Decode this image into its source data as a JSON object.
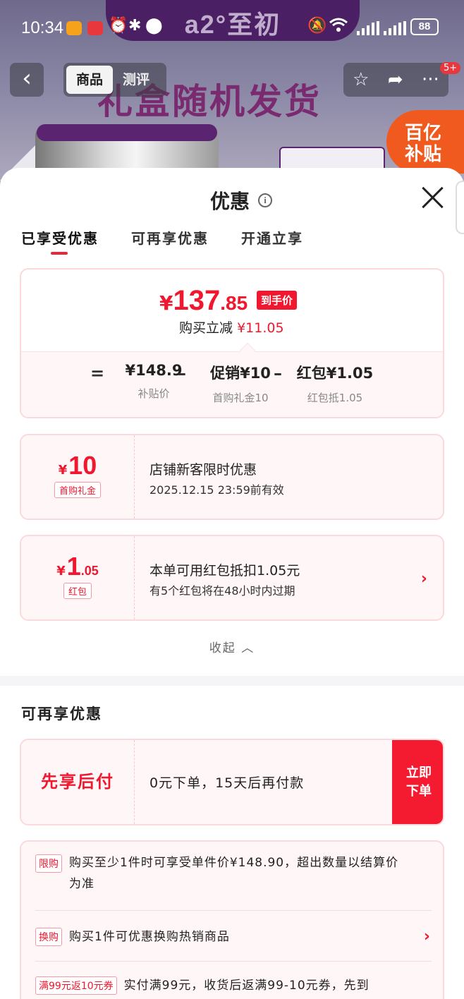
{
  "status_bar": {
    "time": "10:34",
    "battery": "88",
    "network": "6"
  },
  "background": {
    "brand": "a2°至初",
    "banner": "礼盒随机发货",
    "subsidy_badge": "百亿补贴"
  },
  "nav": {
    "tabs": [
      "商品",
      "测评"
    ],
    "active_tab": "商品",
    "badge": "5+"
  },
  "sheet": {
    "title": "优惠",
    "tabs": [
      "已享受优惠",
      "可再享优惠",
      "开通立享"
    ],
    "active_tab_index": 0
  },
  "price_summary": {
    "symbol": "¥",
    "price_int": "137",
    "price_dec": ".85",
    "price_tag": "到手价",
    "reduce_label": "购买立减",
    "reduce_amount": "¥11.05",
    "breakdown": [
      {
        "op": "=",
        "value": "¥148.9",
        "sub": "补贴价"
      },
      {
        "op": "–",
        "value": "促销¥10",
        "sub": "首购礼金10"
      },
      {
        "op": "–",
        "value": "红包¥1.05",
        "sub": "红包抵1.05"
      }
    ]
  },
  "coupons": [
    {
      "symbol": "¥",
      "amount_int": "10",
      "amount_dec": "",
      "label": "首购礼金",
      "title": "店铺新客限时优惠",
      "subtitle": "2025.12.15 23:59前有效",
      "has_chevron": false
    },
    {
      "symbol": "¥",
      "amount_int": "1",
      "amount_dec": ".05",
      "label": "红包",
      "title": "本单可用红包抵扣1.05元",
      "subtitle": "有5个红包将在48小时内过期",
      "has_chevron": true
    }
  ],
  "collapse_label": "收起",
  "more_section": {
    "title": "可再享优惠",
    "pay_later": {
      "label": "先享后付",
      "text": "0元下单，15天后再付款",
      "button": "立即下单"
    },
    "promos": [
      {
        "tag": "限购",
        "text": "购买至少1件时可享受单件价¥148.90，超出数量以结算价为准"
      },
      {
        "tag": "换购",
        "text": "购买1件可优惠换购热销商品"
      },
      {
        "tag": "满99元返10元券",
        "text": "实付满99元，收货后返满99-10元券，先到"
      }
    ]
  },
  "colors": {
    "accent_red": "#f0172e",
    "pink_border": "#fbd9dc",
    "pink_bg": "#fff7f7"
  }
}
